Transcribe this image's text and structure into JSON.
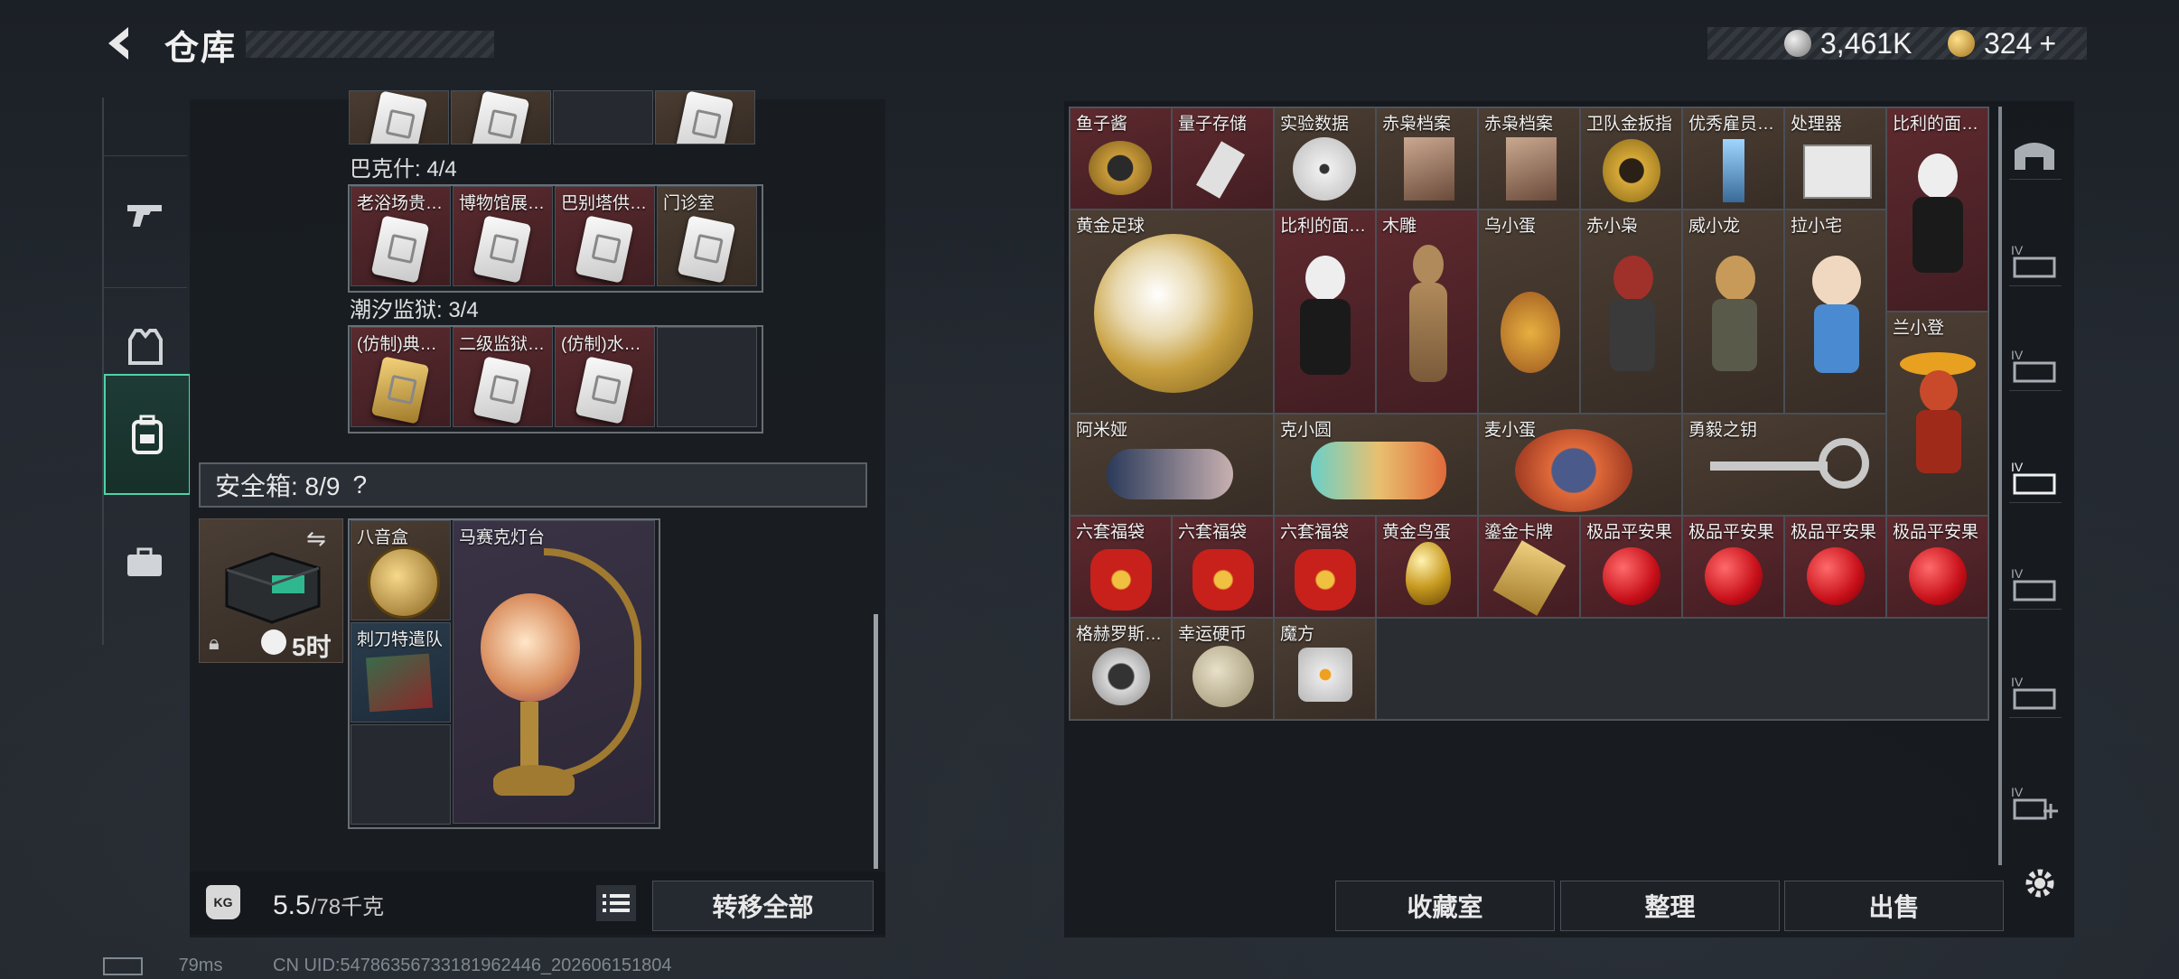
{
  "header": {
    "title": "仓库"
  },
  "currency": [
    {
      "value": "3,461K",
      "icon": "silver-coin-icon",
      "color": "#c8c8c8"
    },
    {
      "value": "324",
      "icon": "gold-coin-icon",
      "color": "#e0b050",
      "suffix": "+"
    }
  ],
  "tabs": [
    {
      "name": "weapons",
      "icon": "gun-icon",
      "active": false
    },
    {
      "name": "armor",
      "icon": "vest-icon",
      "active": false
    },
    {
      "name": "stash",
      "icon": "backpack-icon",
      "active": true
    },
    {
      "name": "cases",
      "icon": "briefcase-icon",
      "active": false
    }
  ],
  "left": {
    "groups": [
      {
        "label": "巴克什: 4/4",
        "items": [
          "老浴场贵…",
          "博物馆展…",
          "巴别塔供…",
          "门诊室"
        ]
      },
      {
        "label": "潮汐监狱: 3/4",
        "items": [
          "(仿制)典…",
          "二级监狱…",
          "(仿制)水…",
          ""
        ]
      }
    ],
    "safe_label": "安全箱: 8/9",
    "safe_help": "?",
    "safe_timer": "5时",
    "safe_items": [
      "八音盒",
      "马赛克灯台",
      "刺刀特遣队"
    ],
    "weight_value": "5.5",
    "weight_total": "/78千克",
    "transfer_label": "转移全部"
  },
  "right": {
    "row1": [
      "鱼子酱",
      "量子存储",
      "实验数据",
      "赤枭档案",
      "赤枭档案",
      "卫队金扳指",
      "优秀雇员…",
      "处理器",
      "比利的面…"
    ],
    "row2": [
      "黄金足球",
      "比利的面…",
      "木雕",
      "乌小蛋",
      "赤小枭",
      "威小龙",
      "拉小宅",
      "兰小登"
    ],
    "row3": [
      "阿米娅",
      "克小圆",
      "麦小蛋",
      "勇毅之钥"
    ],
    "row4": [
      "六套福袋",
      "六套福袋",
      "六套福袋",
      "黄金鸟蛋",
      "鎏金卡牌",
      "极品平安果",
      "极品平安果",
      "极品平安果",
      "极品平安果"
    ],
    "row5": [
      "格赫罗斯…",
      "幸运硬币",
      "魔方"
    ],
    "buttons": {
      "collection": "收藏室",
      "sort": "整理",
      "sell": "出售"
    }
  },
  "status": {
    "ping": "79ms",
    "uid": "CN UID:5478635673318196244​6_202606151804"
  }
}
